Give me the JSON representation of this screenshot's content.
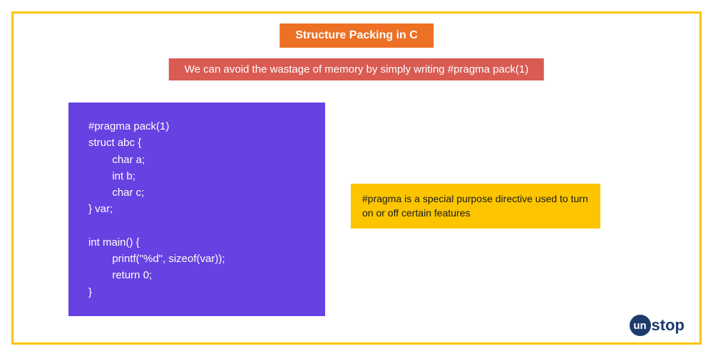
{
  "title": "Structure Packing in C",
  "subtitle": "We can avoid the wastage of memory by simply writing #pragma pack(1)",
  "code": "#pragma pack(1)\nstruct abc {\n        char a;\n        int b;\n        char c;\n} var;\n\nint main() {\n        printf(\"%d\", sizeof(var));\n        return 0;\n}",
  "note": "#pragma is a special purpose directive used to turn on or off certain features",
  "logo": {
    "circle_text": "un",
    "rest_text": "stop"
  }
}
